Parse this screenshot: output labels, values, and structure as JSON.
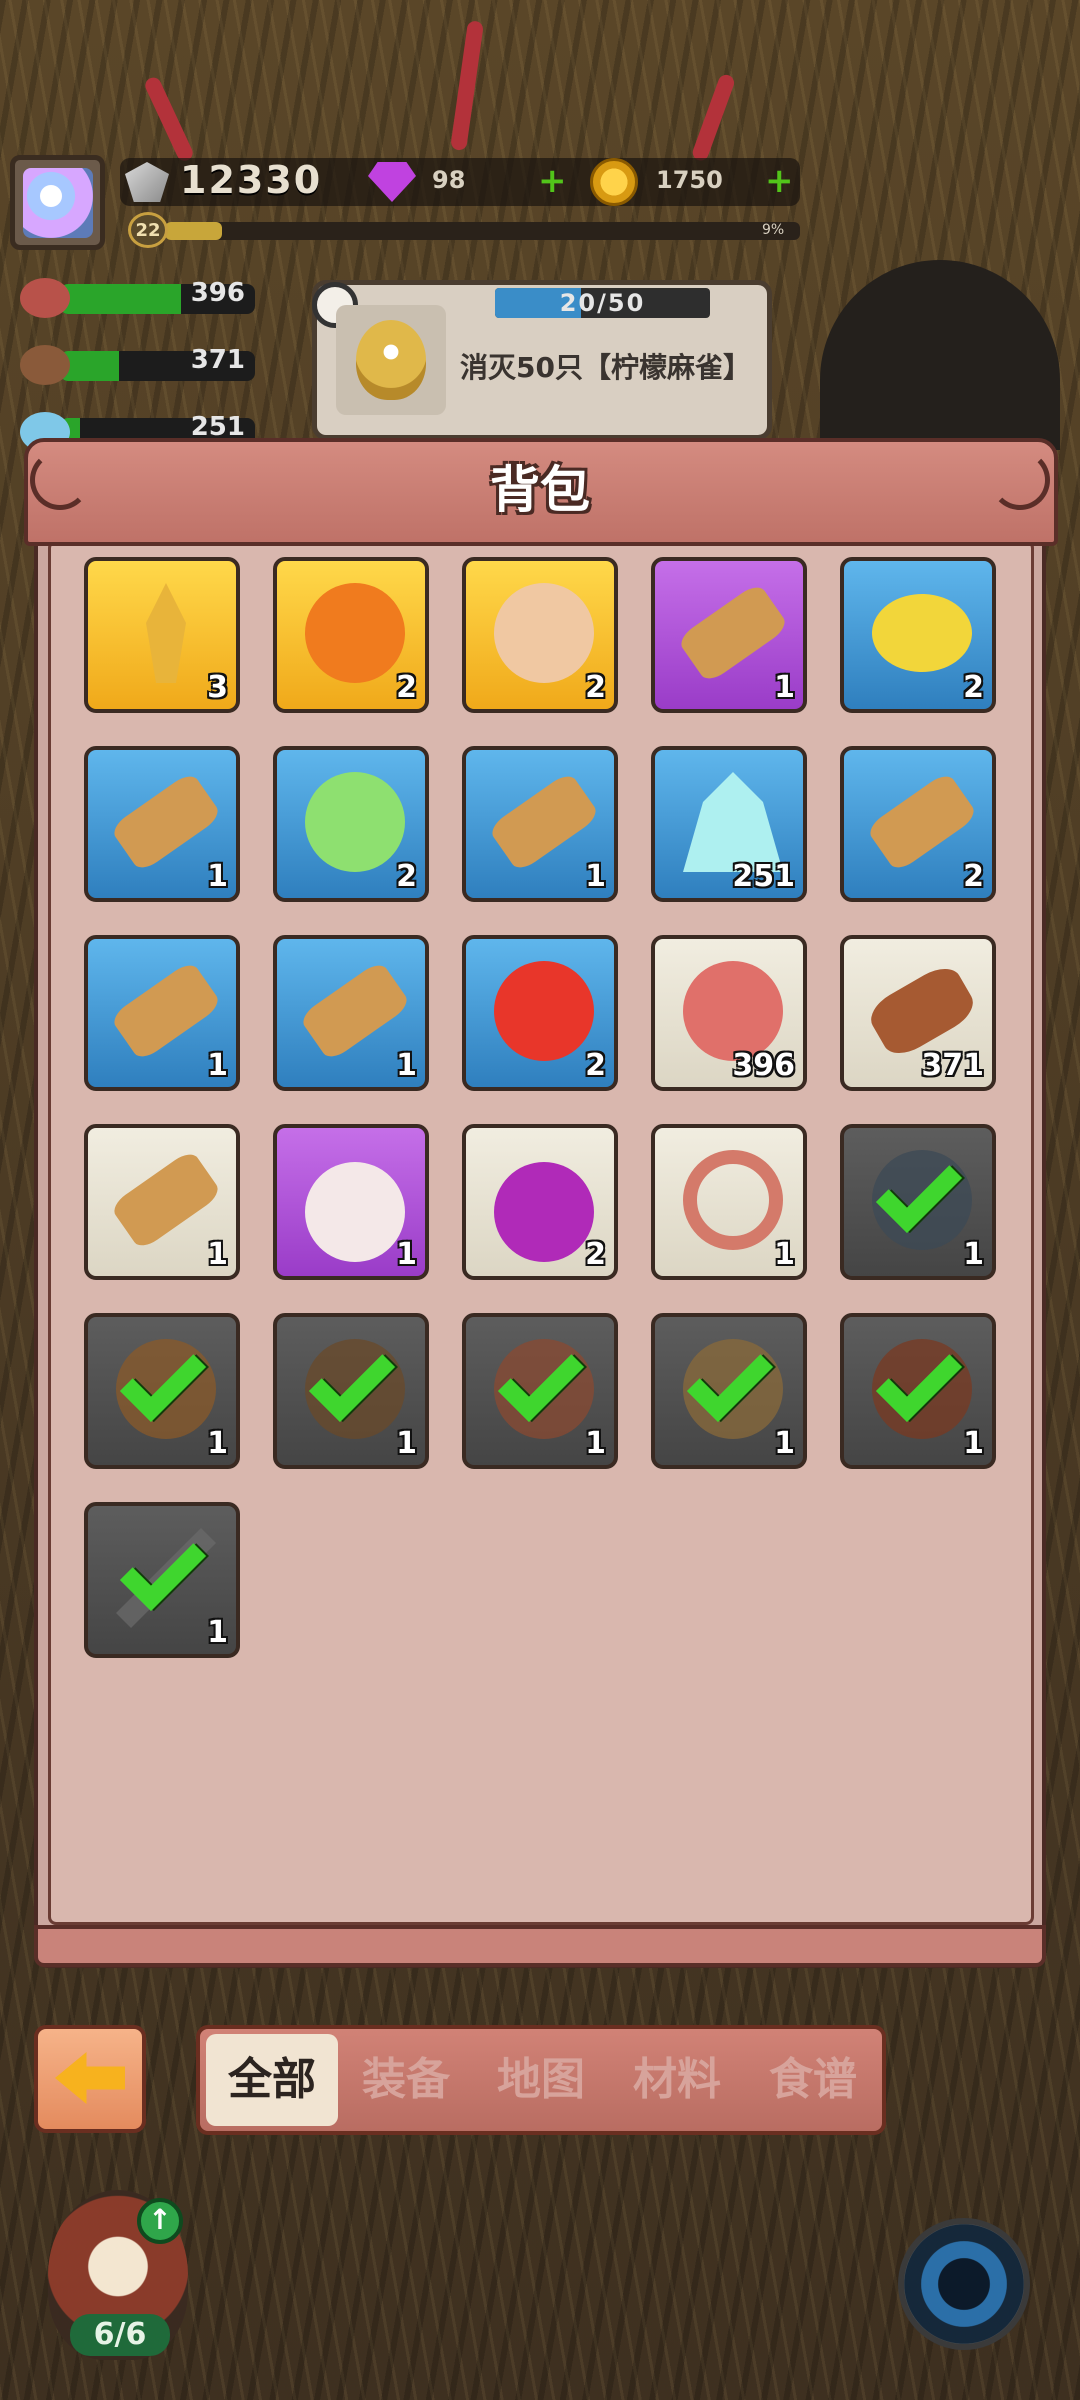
{
  "hud": {
    "power": "12330",
    "gems": "98",
    "coins": "1750",
    "level": "22",
    "xp_percent_text": "9%",
    "xp_fraction": 0.09
  },
  "resources": [
    {
      "name": "meat-icon",
      "value": "396",
      "color": "#b8524a",
      "fill": 0.62
    },
    {
      "name": "log-icon",
      "value": "371",
      "color": "#8a5a3a",
      "fill": 0.3
    },
    {
      "name": "crystal-icon",
      "value": "251",
      "color": "#7fc8e8",
      "fill": 0.1
    }
  ],
  "quest": {
    "progress": "20/50",
    "progress_fraction": 0.4,
    "text": "消灭50只【柠檬麻雀】"
  },
  "panel": {
    "title": "背包"
  },
  "items": [
    {
      "icon": "wheat-icon",
      "rarity": "gold",
      "count": "3",
      "color": "#e8b43a"
    },
    {
      "icon": "pumpkin-icon",
      "rarity": "gold",
      "count": "2",
      "color": "#f07b1e"
    },
    {
      "icon": "egg-icon",
      "rarity": "gold",
      "count": "2",
      "color": "#f0c8a2"
    },
    {
      "icon": "scroll-purple-gem-icon",
      "rarity": "purple",
      "count": "1",
      "color": "#d19a52"
    },
    {
      "icon": "lemon-icon",
      "rarity": "blue",
      "count": "2",
      "color": "#f2d63a"
    },
    {
      "icon": "scroll-white-gem-icon",
      "rarity": "blue",
      "count": "1",
      "color": "#d19a52"
    },
    {
      "icon": "jelly-icon",
      "rarity": "blue",
      "count": "2",
      "color": "#8ee070"
    },
    {
      "icon": "scroll-white-gem-icon",
      "rarity": "blue",
      "count": "1",
      "color": "#d19a52"
    },
    {
      "icon": "crystal-icon",
      "rarity": "blue",
      "count": "251",
      "color": "#aef0f0"
    },
    {
      "icon": "scroll-white-gem-icon",
      "rarity": "blue",
      "count": "2",
      "color": "#d19a52"
    },
    {
      "icon": "scroll-white-gem-icon",
      "rarity": "blue",
      "count": "1",
      "color": "#d19a52"
    },
    {
      "icon": "scroll-white-gem-icon",
      "rarity": "blue",
      "count": "1",
      "color": "#d19a52"
    },
    {
      "icon": "tomato-icon",
      "rarity": "blue",
      "count": "2",
      "color": "#e8362a"
    },
    {
      "icon": "meat-icon",
      "rarity": "white",
      "count": "396",
      "color": "#e0706a"
    },
    {
      "icon": "log-icon",
      "rarity": "white",
      "count": "371",
      "color": "#a65a32"
    },
    {
      "icon": "scroll-gold-gem-icon",
      "rarity": "white",
      "count": "1",
      "color": "#d19a52"
    },
    {
      "icon": "rice-cake-dish-icon",
      "rarity": "purple",
      "count": "1",
      "color": "#f4e8e8"
    },
    {
      "icon": "purple-berry-dish-icon",
      "rarity": "white",
      "count": "2",
      "color": "#b02ab8"
    },
    {
      "icon": "necklace-icon",
      "rarity": "white",
      "count": "1",
      "color": "#d47a6a"
    },
    {
      "icon": "boots-equipped-icon",
      "rarity": "dark",
      "count": "1",
      "color": "#3c4a56",
      "equipped": true
    },
    {
      "icon": "armor-equipped-icon",
      "rarity": "dark",
      "count": "1",
      "color": "#8a5a2a",
      "equipped": true
    },
    {
      "icon": "pants-equipped-icon",
      "rarity": "dark",
      "count": "1",
      "color": "#6a4a2a",
      "equipped": true
    },
    {
      "icon": "gloves-equipped-icon",
      "rarity": "dark",
      "count": "1",
      "color": "#8a4a32",
      "equipped": true
    },
    {
      "icon": "shield-equipped-icon",
      "rarity": "dark",
      "count": "1",
      "color": "#8a6a3a",
      "equipped": true
    },
    {
      "icon": "helmet-equipped-icon",
      "rarity": "dark",
      "count": "1",
      "color": "#7a3a22",
      "equipped": true
    },
    {
      "icon": "sword-equipped-icon",
      "rarity": "dark",
      "count": "1",
      "color": "#6a6a6a",
      "equipped": true
    }
  ],
  "tabs": [
    {
      "label": "全部",
      "active": true
    },
    {
      "label": "装备",
      "active": false
    },
    {
      "label": "地图",
      "active": false
    },
    {
      "label": "材料",
      "active": false
    },
    {
      "label": "食谱",
      "active": false
    }
  ],
  "hero": {
    "count": "6/6"
  }
}
